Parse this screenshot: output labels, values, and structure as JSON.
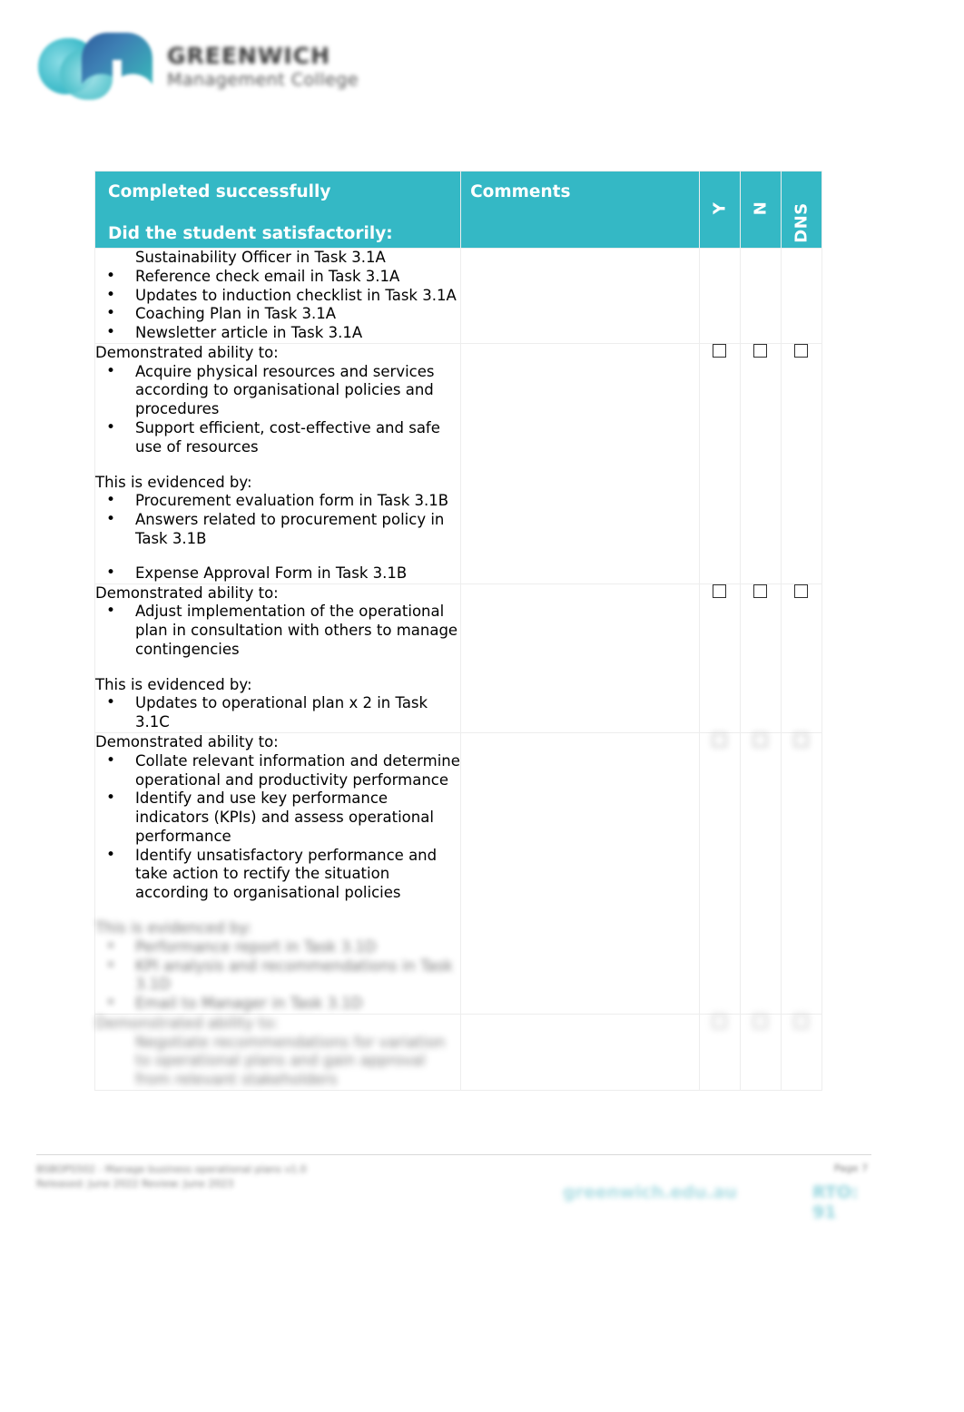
{
  "document": {
    "logo": {
      "icon_name": "gm-monogram-logo",
      "line1": "GREENWICH",
      "line2": "Management College"
    }
  },
  "table": {
    "headers": {
      "criteria_title": "Completed successfully",
      "criteria_subtitle": "Did the student satisfactorily:",
      "comments": "Comments",
      "y": "Y",
      "n": "N",
      "dns": "DNS"
    },
    "rows": [
      {
        "id": "row-1",
        "lead": "",
        "items": [
          {
            "text": "Sustainability Officer in Task 3.1A",
            "bulleted": false,
            "gap_above": false
          },
          {
            "text": "Reference check email in Task 3.1A",
            "bulleted": true,
            "gap_above": false
          },
          {
            "text": "Updates to induction checklist in Task 3.1A",
            "bulleted": true,
            "gap_above": false
          },
          {
            "text": "Coaching Plan in Task 3.1A",
            "bulleted": true,
            "gap_above": false
          },
          {
            "text": "Newsletter article in Task 3.1A",
            "bulleted": true,
            "gap_above": false
          }
        ],
        "evidence_lead": "",
        "evidence_items": [],
        "checkboxes": false,
        "blurred": false
      },
      {
        "id": "row-2",
        "lead": "Demonstrated ability to:",
        "items": [
          {
            "text": "Acquire physical resources and services according to organisational policies and procedures",
            "bulleted": true,
            "gap_above": false
          },
          {
            "text": "Support efficient, cost-effective and safe use of resources",
            "bulleted": true,
            "gap_above": false
          }
        ],
        "evidence_lead": "This is evidenced by:",
        "evidence_items": [
          {
            "text": "Procurement evaluation form in Task 3.1B",
            "bulleted": true,
            "gap_above": false
          },
          {
            "text": "Answers related to procurement policy in Task 3.1B",
            "bulleted": true,
            "gap_above": false
          },
          {
            "text": "Expense Approval Form in Task 3.1B",
            "bulleted": true,
            "gap_above": true
          }
        ],
        "checkboxes": true,
        "blurred": false
      },
      {
        "id": "row-3",
        "lead": "Demonstrated ability to:",
        "items": [
          {
            "text": "Adjust implementation of the operational plan in consultation with others to manage contingencies",
            "bulleted": true,
            "gap_above": false
          }
        ],
        "evidence_lead": "This is evidenced by:",
        "evidence_items": [
          {
            "text": "Updates to operational plan x 2 in Task 3.1C",
            "bulleted": true,
            "gap_above": false
          }
        ],
        "checkboxes": true,
        "blurred": false
      },
      {
        "id": "row-4",
        "lead": "Demonstrated ability to:",
        "items": [
          {
            "text": "Collate relevant information and determine operational and productivity performance",
            "bulleted": true,
            "gap_above": false
          },
          {
            "text": "Identify and use key performance indicators (KPIs) and assess operational performance",
            "bulleted": true,
            "gap_above": false
          },
          {
            "text": "Identify unsatisfactory performance and take action to rectify the situation according to organisational policies",
            "bulleted": true,
            "gap_above": false
          }
        ],
        "evidence_lead": "This is evidenced by:",
        "evidence_items": [
          {
            "text": "Performance report in Task 3.1D",
            "bulleted": true,
            "gap_above": false
          },
          {
            "text": "KPI analysis and recommendations in Task 3.1D",
            "bulleted": true,
            "gap_above": false
          },
          {
            "text": "Email to Manager in Task 3.1D",
            "bulleted": true,
            "gap_above": false
          }
        ],
        "checkboxes": true,
        "blurred": false,
        "evidence_blurred": true
      },
      {
        "id": "row-5",
        "lead": "Demonstrated ability to:",
        "items": [
          {
            "text": "Negotiate recommendations for variation to operational plans and gain approval from relevant stakeholders",
            "bulleted": false,
            "gap_above": false
          }
        ],
        "evidence_lead": "",
        "evidence_items": [],
        "checkboxes": true,
        "blurred": true
      }
    ]
  },
  "footer": {
    "left_line1": "BSBOPS502 - Manage business operational plans v1.0",
    "left_line2": "Released: June 2022        Review: June 2023",
    "page_number": "Page 7",
    "brand_text": "greenwich.edu.au",
    "brand_text_2": "RTO: 91 "
  }
}
